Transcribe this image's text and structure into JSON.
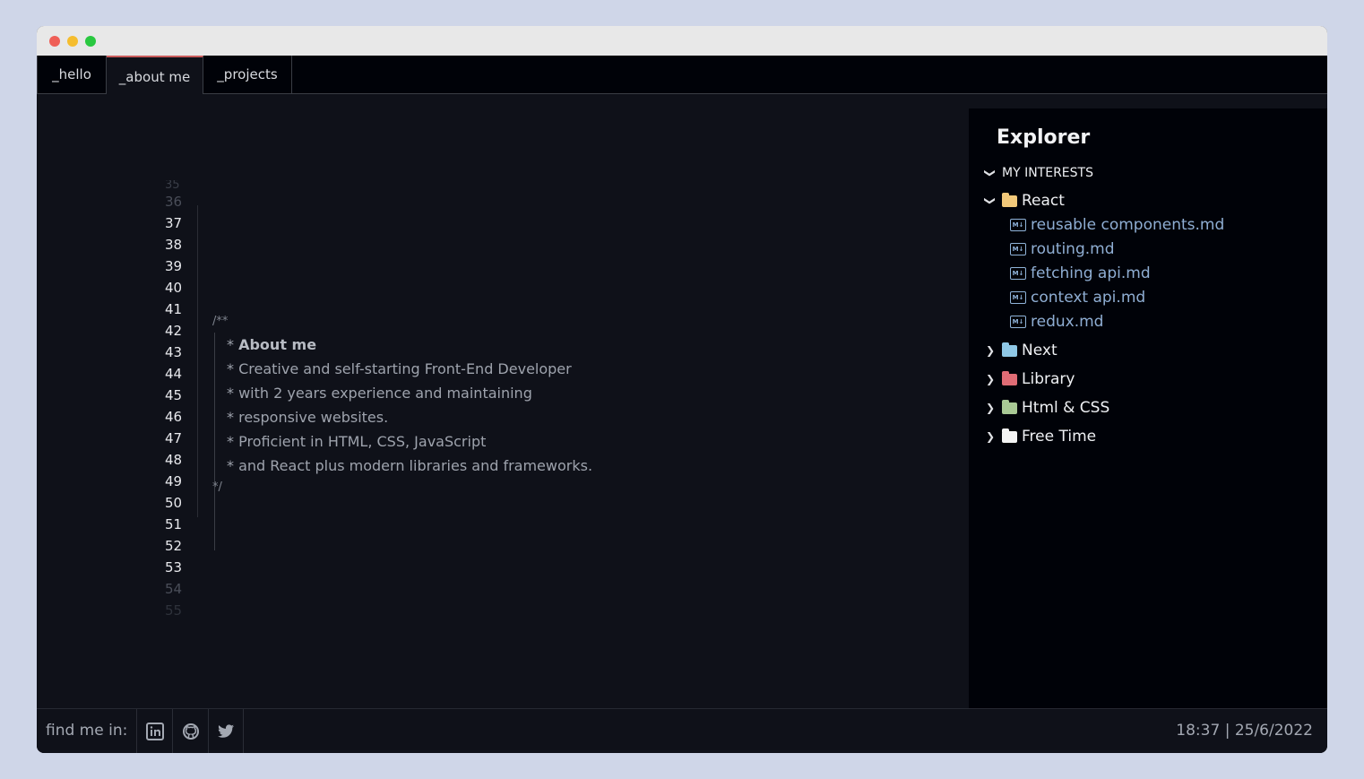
{
  "tabs": [
    {
      "label": "_hello"
    },
    {
      "label": "_about me"
    },
    {
      "label": "_projects"
    }
  ],
  "editor": {
    "line_numbers": [
      "35",
      "36",
      "37",
      "38",
      "39",
      "40",
      "41",
      "42",
      "43",
      "44",
      "45",
      "46",
      "47",
      "48",
      "49",
      "50",
      "51",
      "52",
      "53",
      "54",
      "55"
    ],
    "comment_open": "/**",
    "comment_close": "*/",
    "lines": [
      {
        "prefix": "* ",
        "text": "About me"
      },
      {
        "prefix": "* ",
        "text": "Creative and self-starting Front-End Developer"
      },
      {
        "prefix": "* ",
        "text": "with 2 years experience and maintaining"
      },
      {
        "prefix": "* ",
        "text": "responsive websites."
      },
      {
        "prefix": "* ",
        "text": "Proficient in HTML, CSS, JavaScript"
      },
      {
        "prefix": "* ",
        "text": "and React plus modern libraries and frameworks."
      }
    ]
  },
  "explorer": {
    "title": "Explorer",
    "section": "MY INTERESTS",
    "react": {
      "label": "React",
      "color": "#f2c97a",
      "files": [
        "reusable components.md",
        "routing.md",
        "fetching api.md",
        "context api.md",
        "redux.md"
      ]
    },
    "folders": [
      {
        "label": "Next",
        "color": "#8fc8e6"
      },
      {
        "label": "Library",
        "color": "#e06c75"
      },
      {
        "label": "Html & CSS",
        "color": "#a9c995"
      },
      {
        "label": "Free Time",
        "color": "#f4f4f4"
      }
    ]
  },
  "footer": {
    "find_me": "find me in:",
    "socials": [
      "linkedin-icon",
      "github-icon",
      "twitter-icon"
    ],
    "datetime": "18:37 | 25/6/2022"
  }
}
